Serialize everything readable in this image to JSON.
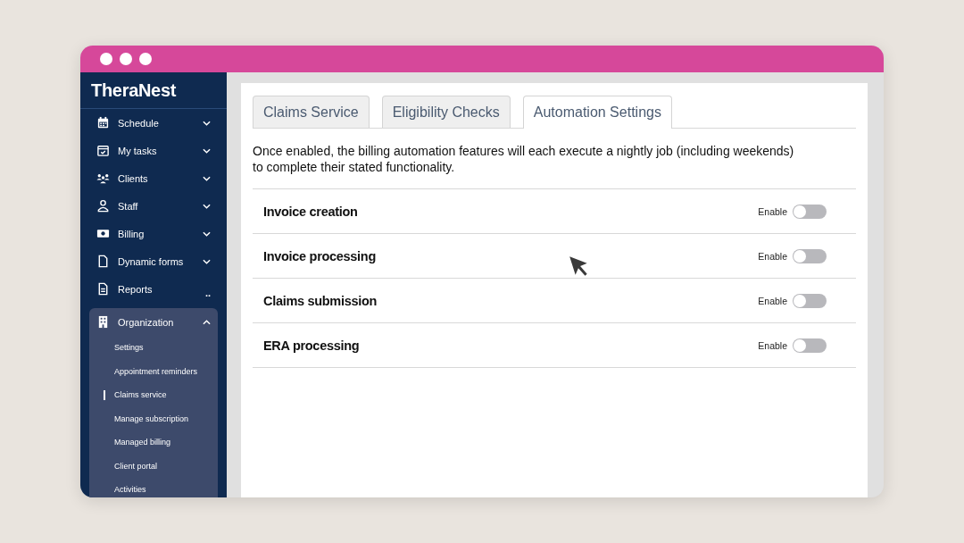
{
  "sidebar": {
    "logo": "TheraNest",
    "items": [
      {
        "kind": "calendar",
        "label": "Schedule",
        "expanded": false
      },
      {
        "kind": "tasks",
        "label": "My tasks",
        "expanded": false
      },
      {
        "kind": "clients",
        "label": "Clients",
        "expanded": false
      },
      {
        "kind": "staff",
        "label": "Staff",
        "expanded": false
      },
      {
        "kind": "billing",
        "label": "Billing",
        "expanded": false
      },
      {
        "kind": "forms",
        "label": "Dynamic forms",
        "expanded": false
      },
      {
        "kind": "reports",
        "label": "Reports",
        "more": ".."
      },
      {
        "kind": "building",
        "label": "Organization",
        "expanded": true,
        "children": [
          {
            "label": "Settings",
            "selected": false
          },
          {
            "label": "Appointment reminders",
            "selected": false
          },
          {
            "label": "Claims service",
            "selected": true
          },
          {
            "label": "Manage subscription",
            "selected": false
          },
          {
            "label": "Managed billing",
            "selected": false
          },
          {
            "label": "Client portal",
            "selected": false
          },
          {
            "label": "Activities",
            "selected": false
          }
        ]
      }
    ]
  },
  "tabs": [
    {
      "label": "Claims Service",
      "selected": false
    },
    {
      "label": "Eligibility Checks",
      "selected": false
    },
    {
      "label": "Automation Settings",
      "selected": true
    }
  ],
  "description": "Once enabled, the billing automation features will each execute a nightly job (including weekends) to complete their stated functionality.",
  "settings": [
    {
      "name": "Invoice creation",
      "toggle_label": "Enable",
      "on": false
    },
    {
      "name": "Invoice processing",
      "toggle_label": "Enable",
      "on": false
    },
    {
      "name": "Claims submission",
      "toggle_label": "Enable",
      "on": false
    },
    {
      "name": "ERA processing",
      "toggle_label": "Enable",
      "on": false
    }
  ]
}
